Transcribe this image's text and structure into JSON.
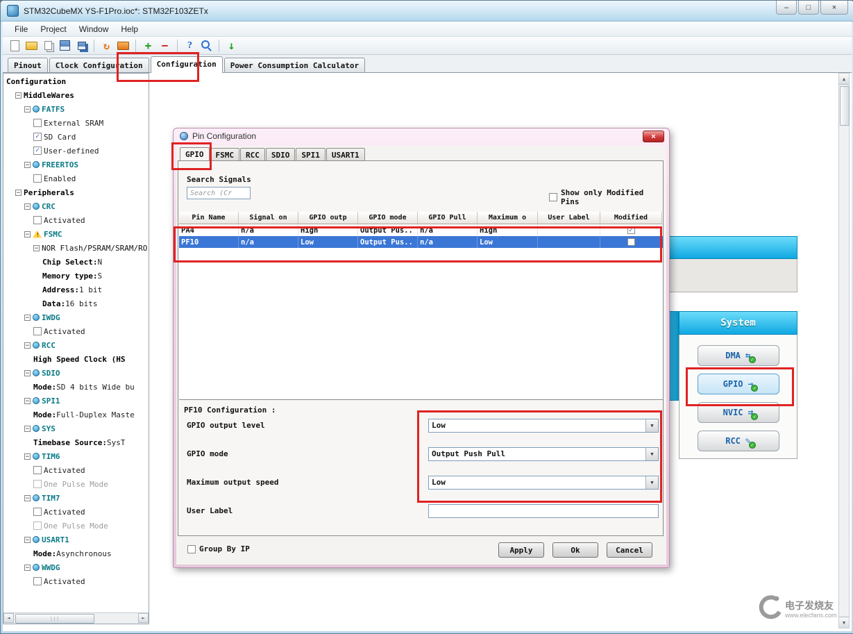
{
  "window": {
    "title": "STM32CubeMX YS-F1Pro.ioc*: STM32F103ZETx",
    "buttons": {
      "minimize": "–",
      "maximize": "□",
      "close": "×"
    }
  },
  "menu": {
    "items": [
      "File",
      "Project",
      "Window",
      "Help"
    ]
  },
  "toolbar": {
    "icons": [
      "new-file-icon",
      "open-icon",
      "copy-icon",
      "save-icon",
      "save-all-icon",
      "separator",
      "refresh-icon",
      "generate-icon",
      "separator",
      "plus-icon",
      "minus-icon",
      "separator",
      "help-icon",
      "search-icon",
      "separator",
      "generate-code-icon"
    ]
  },
  "main_tabs": {
    "items": [
      "Pinout",
      "Clock Configuration",
      "Configuration",
      "Power Consumption Calculator"
    ],
    "active": 2
  },
  "tree": {
    "nodes": [
      {
        "d": 0,
        "t": "root",
        "l": "Configuration"
      },
      {
        "d": 1,
        "t": "branch",
        "l": "MiddleWares"
      },
      {
        "d": 2,
        "t": "periph",
        "l": "FATFS"
      },
      {
        "d": 3,
        "t": "check",
        "l": "External SRAM",
        "chk": false
      },
      {
        "d": 3,
        "t": "check",
        "l": "SD Card",
        "chk": true
      },
      {
        "d": 3,
        "t": "check",
        "l": "User-defined",
        "chk": true
      },
      {
        "d": 2,
        "t": "periph",
        "l": "FREERTOS"
      },
      {
        "d": 3,
        "t": "check",
        "l": "Enabled",
        "chk": false
      },
      {
        "d": 1,
        "t": "branch",
        "l": "Peripherals"
      },
      {
        "d": 2,
        "t": "periph",
        "l": "CRC"
      },
      {
        "d": 3,
        "t": "check",
        "l": "Activated",
        "chk": false
      },
      {
        "d": 2,
        "t": "warnperiph",
        "l": "FSMC"
      },
      {
        "d": 3,
        "t": "textbranch",
        "l": "NOR Flash/PSRAM/SRAM/RO"
      },
      {
        "d": 4,
        "t": "prop",
        "b": "Chip Select:",
        "l": "N"
      },
      {
        "d": 4,
        "t": "prop",
        "b": "Memory type:",
        "l": "S"
      },
      {
        "d": 4,
        "t": "prop",
        "b": "Address:",
        "l": "1 bit"
      },
      {
        "d": 4,
        "t": "prop",
        "b": "Data:",
        "l": "16 bits"
      },
      {
        "d": 2,
        "t": "periph",
        "l": "IWDG"
      },
      {
        "d": 3,
        "t": "check",
        "l": "Activated",
        "chk": false
      },
      {
        "d": 2,
        "t": "periph",
        "l": "RCC"
      },
      {
        "d": 3,
        "t": "prop",
        "b": "High Speed Clock (HS",
        "l": ""
      },
      {
        "d": 2,
        "t": "periph",
        "l": "SDIO"
      },
      {
        "d": 3,
        "t": "prop",
        "b": "Mode:",
        "l": "SD 4 bits Wide bu"
      },
      {
        "d": 2,
        "t": "periph",
        "l": "SPI1"
      },
      {
        "d": 3,
        "t": "prop",
        "b": "Mode:",
        "l": "Full-Duplex Maste"
      },
      {
        "d": 2,
        "t": "periph",
        "l": "SYS"
      },
      {
        "d": 3,
        "t": "prop",
        "b": "Timebase Source:",
        "l": "SysT"
      },
      {
        "d": 2,
        "t": "periph",
        "l": "TIM6"
      },
      {
        "d": 3,
        "t": "check",
        "l": "Activated",
        "chk": false
      },
      {
        "d": 3,
        "t": "check",
        "l": "One Pulse Mode",
        "chk": false,
        "gray": true
      },
      {
        "d": 2,
        "t": "periph",
        "l": "TIM7"
      },
      {
        "d": 3,
        "t": "check",
        "l": "Activated",
        "chk": false
      },
      {
        "d": 3,
        "t": "check",
        "l": "One Pulse Mode",
        "chk": false,
        "gray": true
      },
      {
        "d": 2,
        "t": "periph",
        "l": "USART1"
      },
      {
        "d": 3,
        "t": "prop",
        "b": "Mode:",
        "l": "Asynchronous"
      },
      {
        "d": 2,
        "t": "periph",
        "l": "WWDG"
      },
      {
        "d": 3,
        "t": "check",
        "l": "Activated",
        "chk": false
      }
    ]
  },
  "dialog": {
    "title": "Pin Configuration",
    "close_glyph": "×",
    "tabs": [
      "GPIO",
      "FSMC",
      "RCC",
      "SDIO",
      "SPI1",
      "USART1"
    ],
    "active_tab": 0,
    "search_label": "Search Signals",
    "search_placeholder": "Search (Cr",
    "show_only_modified": "Show only Modified Pins",
    "table": {
      "columns": [
        "Pin Name",
        "Signal on",
        "GPIO outp",
        "GPIO mode",
        "GPIO Pull",
        "Maximum o",
        "User Label",
        "Modified"
      ],
      "rows": [
        {
          "cells": [
            "PA4",
            "n/a",
            "High",
            "Output Pus..",
            "n/a",
            "High",
            ""
          ],
          "modified": true,
          "selected": false
        },
        {
          "cells": [
            "PF10",
            "n/a",
            "Low",
            "Output Pus..",
            "n/a",
            "Low",
            ""
          ],
          "modified": false,
          "selected": true
        }
      ]
    },
    "config": {
      "title": "PF10 Configuration :",
      "fields": [
        {
          "label": "GPIO output level",
          "type": "select",
          "value": "Low"
        },
        {
          "label": "GPIO mode",
          "type": "select",
          "value": "Output Push Pull"
        },
        {
          "label": "Maximum output speed",
          "type": "select",
          "value": "Low"
        },
        {
          "label": "User Label",
          "type": "text",
          "value": ""
        }
      ]
    },
    "group_by_ip": "Group By IP",
    "buttons": [
      "Apply",
      "Ok",
      "Cancel"
    ]
  },
  "system_panel": {
    "title": "System",
    "buttons": [
      {
        "label": "DMA",
        "icon": "dma-icon",
        "glyph": "⇆"
      },
      {
        "label": "GPIO",
        "icon": "gpio-icon",
        "glyph": "→",
        "highlighted": true
      },
      {
        "label": "NVIC",
        "icon": "nvic-icon",
        "glyph": "⇉"
      },
      {
        "label": "RCC",
        "icon": "rcc-icon",
        "glyph": "✎"
      }
    ]
  },
  "watermark": {
    "line1": "电子发烧友",
    "line2": "www.elecfans.com"
  }
}
